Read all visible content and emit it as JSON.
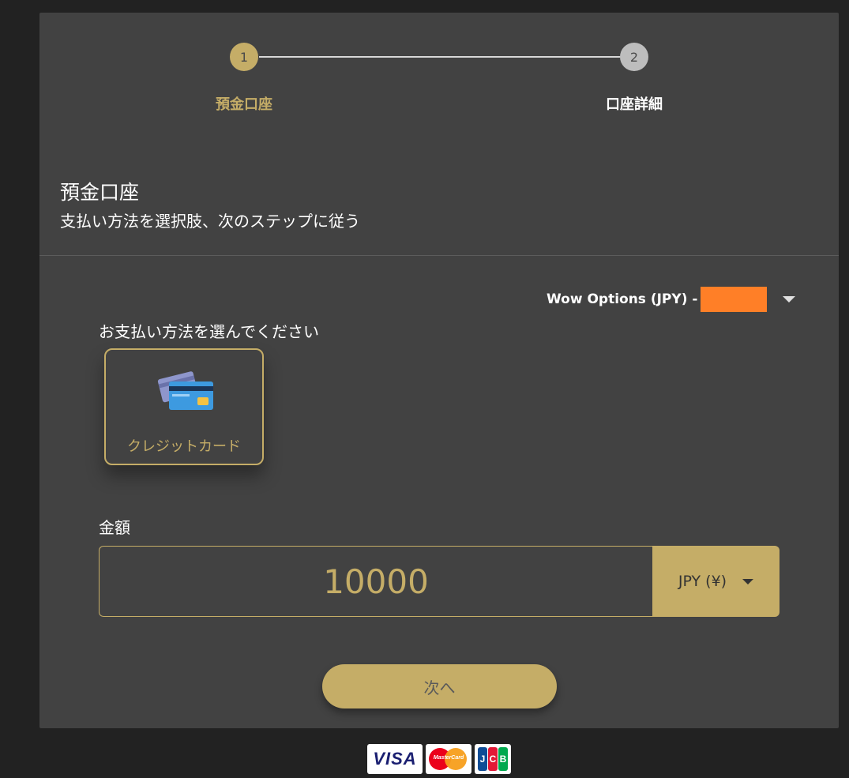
{
  "stepper": {
    "steps": [
      {
        "number": "1",
        "label": "預金口座",
        "active": true
      },
      {
        "number": "2",
        "label": "口座詳細",
        "active": false
      }
    ]
  },
  "section": {
    "title": "預金口座",
    "subtitle": "支払い方法を選択肢、次のステップに従う"
  },
  "account": {
    "label": "Wow Options (JPY) -",
    "redacted_color": "#ff7f27"
  },
  "payment": {
    "prompt": "お支払い方法を選んでください",
    "methods": [
      {
        "label": "クレジットカード",
        "icon": "credit-card-icon",
        "selected": true
      }
    ]
  },
  "amount": {
    "label": "金額",
    "value": "10000",
    "currency": "JPY (¥)"
  },
  "actions": {
    "next_label": "次へ"
  },
  "card_brands": {
    "visa": "VISA",
    "mastercard": "MasterCard",
    "jcb": [
      "J",
      "C",
      "B"
    ]
  },
  "colors": {
    "accent": "#c5ad67",
    "panel": "#424242",
    "background": "#222222"
  }
}
